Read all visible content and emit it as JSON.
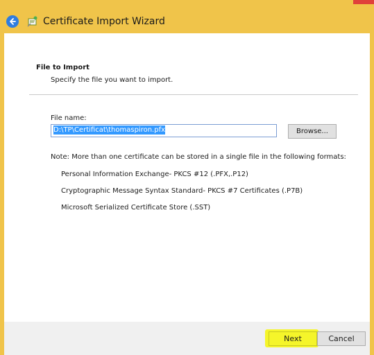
{
  "window": {
    "title": "Certificate Import Wizard"
  },
  "section": {
    "title": "File to Import",
    "subtitle": "Specify the file you want to import."
  },
  "file": {
    "label": "File name:",
    "value": "D:\\TP\\Certificat\\thomaspiron.pfx",
    "browse_label": "Browse..."
  },
  "note": {
    "text": "Note:  More than one certificate can be stored in a single file in the following formats:",
    "formats": [
      "Personal Information Exchange- PKCS #12 (.PFX,.P12)",
      "Cryptographic Message Syntax Standard- PKCS #7 Certificates (.P7B)",
      "Microsoft Serialized Certificate Store (.SST)"
    ]
  },
  "footer": {
    "next_label": "Next",
    "cancel_label": "Cancel"
  },
  "colors": {
    "titlebar": "#f0c44a",
    "highlight": "#f5f52a",
    "back_button": "#2f7de0"
  },
  "icons": [
    "back-arrow-icon",
    "certificate-wizard-icon"
  ]
}
